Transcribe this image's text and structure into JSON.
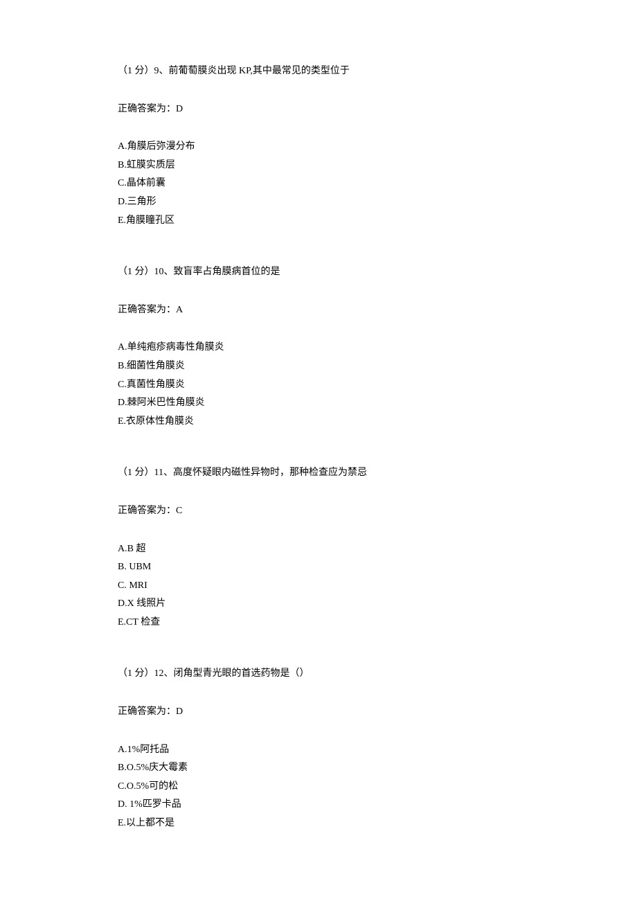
{
  "questions": [
    {
      "header": "（1 分）9、前葡萄膜炎出现 KP,其中最常见的类型位于",
      "answer": "正确答案为：D",
      "options": [
        "A.角膜后弥漫分布",
        "B.虹膜实质层",
        "C.晶体前囊",
        "D.三角形",
        "E.角膜瞳孔区"
      ]
    },
    {
      "header": "（1 分）10、致盲率占角膜病首位的是",
      "answer": "正确答案为：A",
      "options": [
        "A.单纯疱疹病毒性角膜炎",
        "B.细菌性角膜炎",
        "C.真菌性角膜炎",
        "D.棘阿米巴性角膜炎",
        "E.衣原体性角膜炎"
      ]
    },
    {
      "header": "（1 分）11、高度怀疑眼内磁性异物时，那种检查应为禁忌",
      "answer": "正确答案为：C",
      "options": [
        "A.B 超",
        "B.  UBM",
        "C.  MRI",
        "D.X 线照片",
        "E.CT 检查"
      ]
    },
    {
      "header": "（1 分）12、闭角型青光眼的首选药物是（）",
      "answer": "正确答案为：D",
      "options": [
        "A.1%阿托品",
        "B.O.5%庆大霉素",
        "C.O.5%可的松",
        "D.  1%匹罗卡品",
        "E.以上都不是"
      ]
    }
  ]
}
